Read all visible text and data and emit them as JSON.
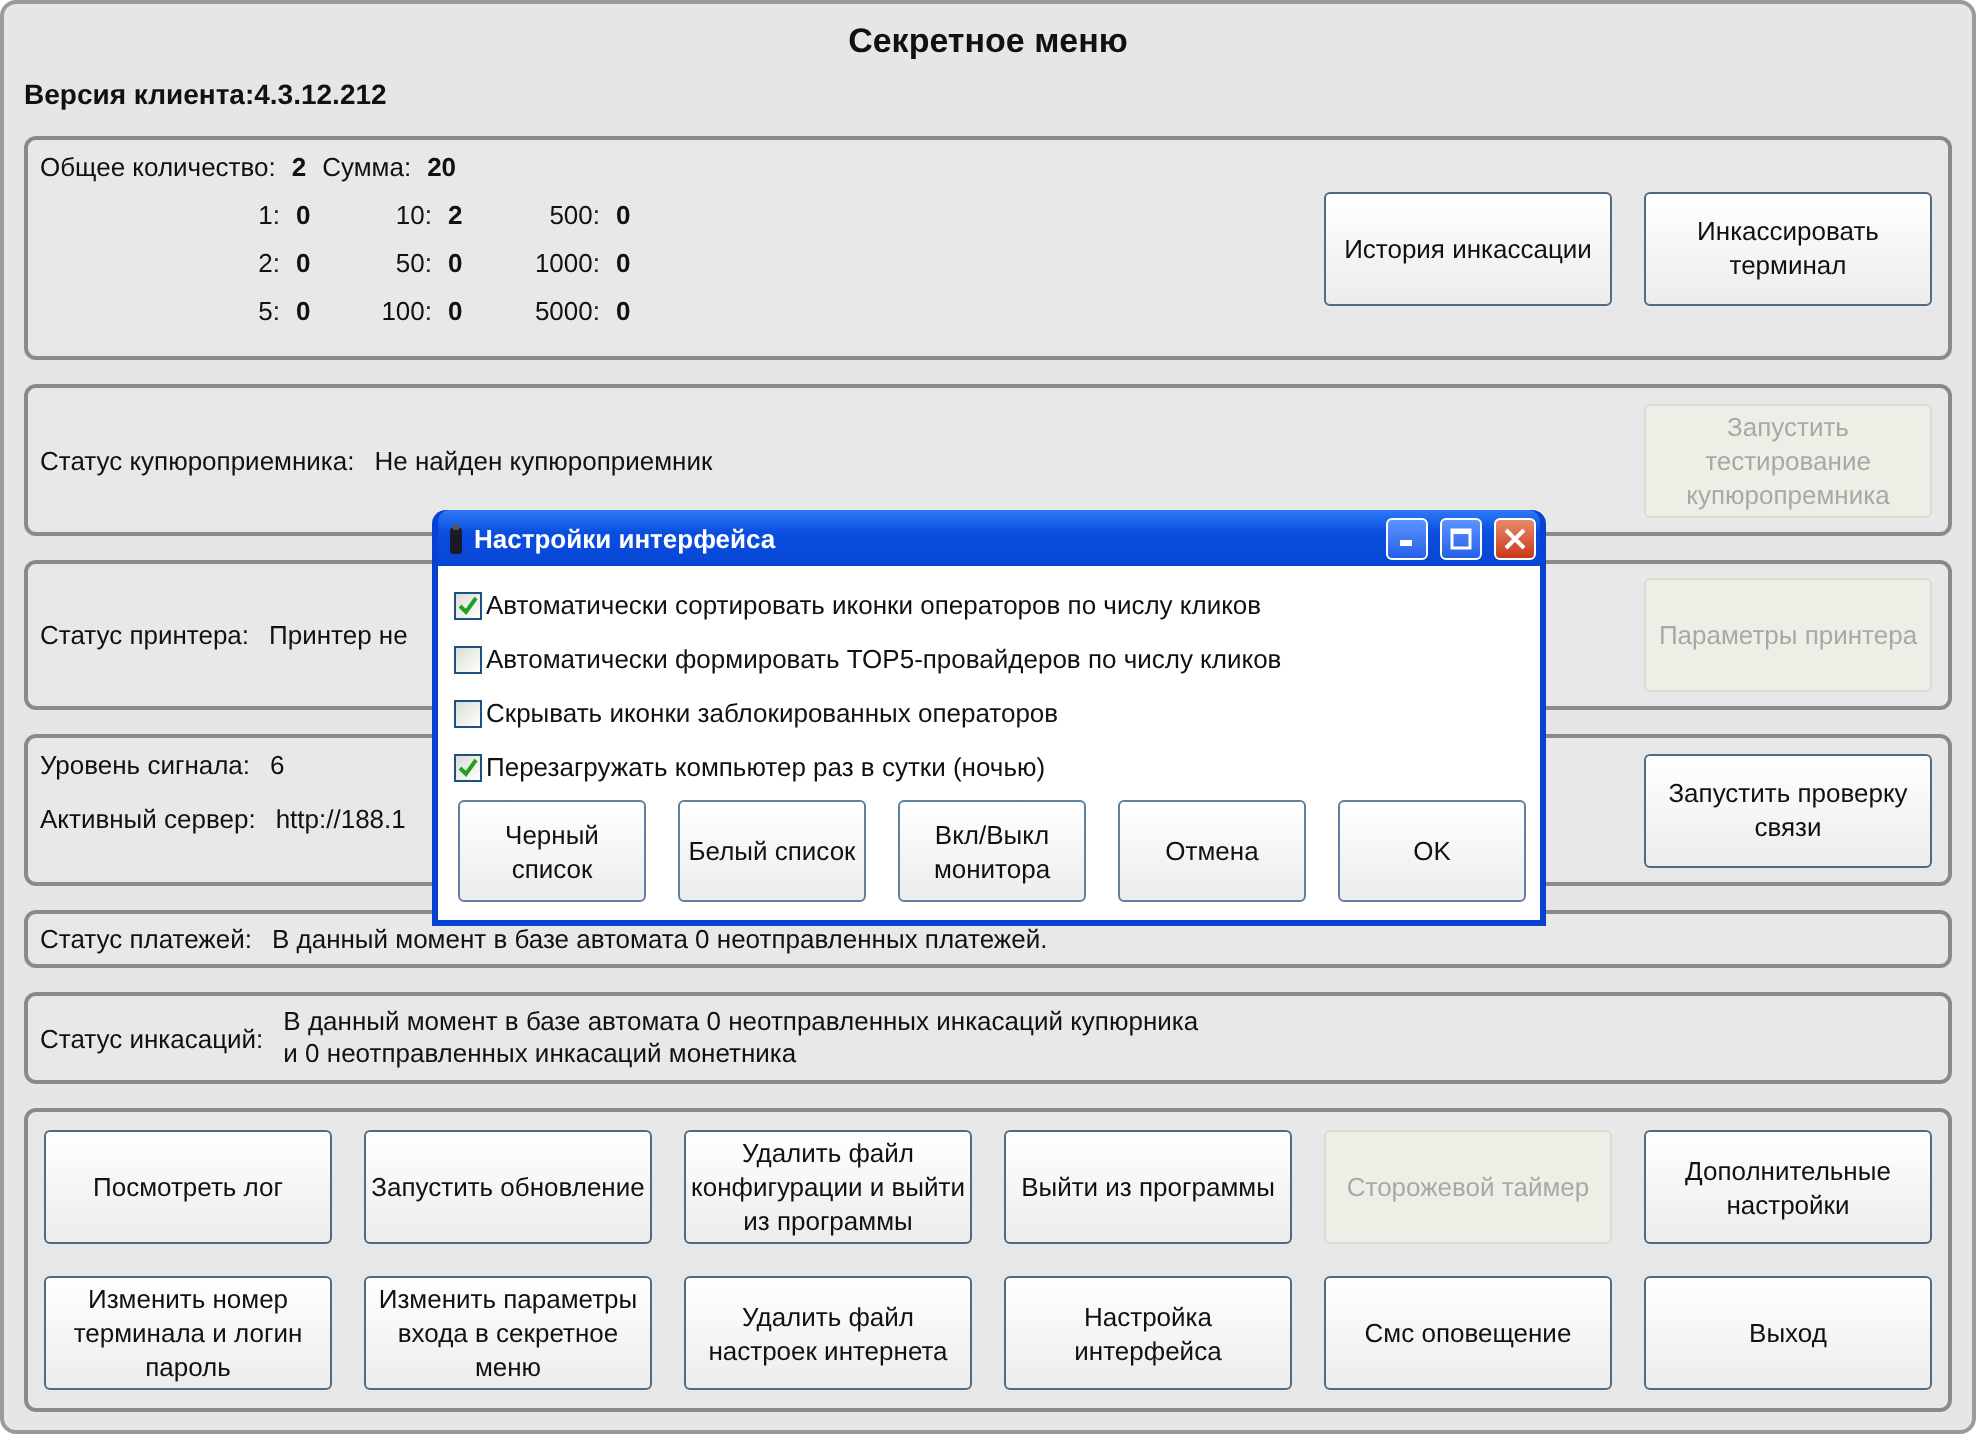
{
  "window": {
    "title": "Секретное меню"
  },
  "version": "Версия клиента:4.3.12.212",
  "cash": {
    "total_label": "Общее количество:",
    "total": "2",
    "sum_label": "Сумма:",
    "sum": "20",
    "denominations": [
      {
        "label": "1:",
        "value": "0"
      },
      {
        "label": "10:",
        "value": "2"
      },
      {
        "label": "500:",
        "value": "0"
      },
      {
        "label": "2:",
        "value": "0"
      },
      {
        "label": "50:",
        "value": "0"
      },
      {
        "label": "1000:",
        "value": "0"
      },
      {
        "label": "5:",
        "value": "0"
      },
      {
        "label": "100:",
        "value": "0"
      },
      {
        "label": "5000:",
        "value": "0"
      }
    ],
    "buttons": [
      {
        "label": "История инкассации",
        "disabled": false
      },
      {
        "label": "Инкассировать терминал",
        "disabled": false
      }
    ]
  },
  "bill_acceptor": {
    "label": "Статус купюроприемника:",
    "value": "Не найден купюроприемник",
    "button": {
      "label": "Запустить тестирование купюропремника",
      "disabled": true
    }
  },
  "printer": {
    "label": "Статус принтера:",
    "value": "Принтер не",
    "button": {
      "label": "Параметры принтера",
      "disabled": true
    }
  },
  "connection": {
    "rows": [
      {
        "label": "Уровень сигнала:",
        "value": "6"
      },
      {
        "label": "Активный сервер:",
        "value": "http://188.1"
      }
    ],
    "button": {
      "label": "Запустить проверку связи",
      "disabled": false
    }
  },
  "payments": {
    "label": "Статус платежей:",
    "value": "В данный момент в базе автомата 0 неотправленных платежей."
  },
  "collections": {
    "label": "Статус инкасаций:",
    "lines": [
      "В данный момент в базе автомата 0 неотправленных инкасаций купюрника",
      "и 0 неотправленных инкасаций монетника"
    ]
  },
  "actions": [
    {
      "label": "Посмотреть лог",
      "disabled": false
    },
    {
      "label": "Запустить обновление",
      "disabled": false
    },
    {
      "label": "Удалить файл конфигурации и выйти из программы",
      "disabled": false
    },
    {
      "label": "Выйти из программы",
      "disabled": false
    },
    {
      "label": "Сторожевой таймер",
      "disabled": true
    },
    {
      "label": "Дополнительные настройки",
      "disabled": false
    },
    {
      "label": "Изменить номер терминала и логин пароль",
      "disabled": false
    },
    {
      "label": "Изменить параметры входа в секретное меню",
      "disabled": false
    },
    {
      "label": "Удалить файл настроек интернета",
      "disabled": false
    },
    {
      "label": "Настройка интерфейса",
      "disabled": false
    },
    {
      "label": "Смс оповещение",
      "disabled": false
    },
    {
      "label": "Выход",
      "disabled": false
    }
  ],
  "dialog": {
    "title": "Настройки интерфейса",
    "options": [
      {
        "label": "Автоматически сортировать иконки операторов по числу кликов",
        "checked": true
      },
      {
        "label": "Автоматически формировать TOP5-провайдеров по числу кликов",
        "checked": false
      },
      {
        "label": "Скрывать иконки заблокированных операторов",
        "checked": false
      },
      {
        "label": "Перезагружать компьютер раз в сутки (ночью)",
        "checked": true
      }
    ],
    "buttons": [
      {
        "label": "Черный список"
      },
      {
        "label": "Белый список"
      },
      {
        "label": "Вкл/Выкл монитора"
      },
      {
        "label": "Отмена"
      },
      {
        "label": "OK"
      }
    ]
  }
}
